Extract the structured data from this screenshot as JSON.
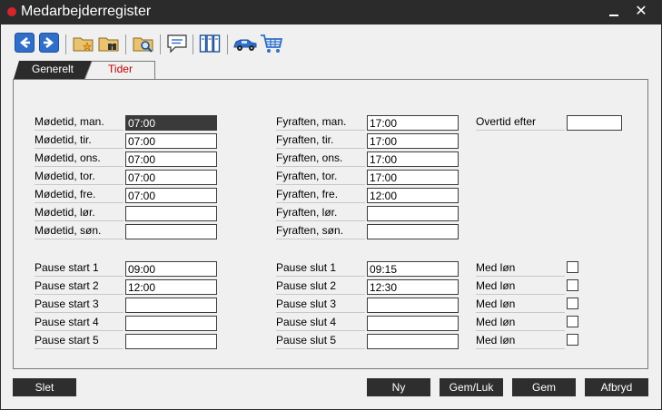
{
  "window": {
    "title": "Medarbejderregister"
  },
  "tabs": {
    "general": "Generelt",
    "times": "Tider"
  },
  "toolbar": {
    "icons": [
      "arrow-left-icon",
      "arrow-right-icon",
      "folder-star-icon",
      "folder-binoculars-icon",
      "folder-search-icon",
      "speech-bubble-icon",
      "binders-icon",
      "car-icon",
      "shopping-cart-icon"
    ]
  },
  "times": {
    "meeting": [
      {
        "label": "Mødetid, man.",
        "value": "07:00"
      },
      {
        "label": "Mødetid, tir.",
        "value": "07:00"
      },
      {
        "label": "Mødetid, ons.",
        "value": "07:00"
      },
      {
        "label": "Mødetid, tor.",
        "value": "07:00"
      },
      {
        "label": "Mødetid, fre.",
        "value": "07:00"
      },
      {
        "label": "Mødetid, lør.",
        "value": ""
      },
      {
        "label": "Mødetid, søn.",
        "value": ""
      }
    ],
    "end": [
      {
        "label": "Fyraften, man.",
        "value": "17:00"
      },
      {
        "label": "Fyraften, tir.",
        "value": "17:00"
      },
      {
        "label": "Fyraften, ons.",
        "value": "17:00"
      },
      {
        "label": "Fyraften, tor.",
        "value": "17:00"
      },
      {
        "label": "Fyraften, fre.",
        "value": "12:00"
      },
      {
        "label": "Fyraften, lør.",
        "value": ""
      },
      {
        "label": "Fyraften, søn.",
        "value": ""
      }
    ],
    "overtime": {
      "label": "Overtid efter",
      "value": ""
    }
  },
  "pauses": [
    {
      "start_label": "Pause start 1",
      "start": "09:00",
      "end_label": "Pause slut 1",
      "end": "09:15",
      "paid_label": "Med løn",
      "paid": false
    },
    {
      "start_label": "Pause start 2",
      "start": "12:00",
      "end_label": "Pause slut 2",
      "end": "12:30",
      "paid_label": "Med løn",
      "paid": false
    },
    {
      "start_label": "Pause start 3",
      "start": "",
      "end_label": "Pause slut 3",
      "end": "",
      "paid_label": "Med løn",
      "paid": false
    },
    {
      "start_label": "Pause start 4",
      "start": "",
      "end_label": "Pause slut 4",
      "end": "",
      "paid_label": "Med løn",
      "paid": false
    },
    {
      "start_label": "Pause start 5",
      "start": "",
      "end_label": "Pause slut 5",
      "end": "",
      "paid_label": "Med løn",
      "paid": false
    }
  ],
  "buttons": {
    "delete": "Slet",
    "new": "Ny",
    "save_close": "Gem/Luk",
    "save": "Gem",
    "cancel": "Afbryd"
  }
}
